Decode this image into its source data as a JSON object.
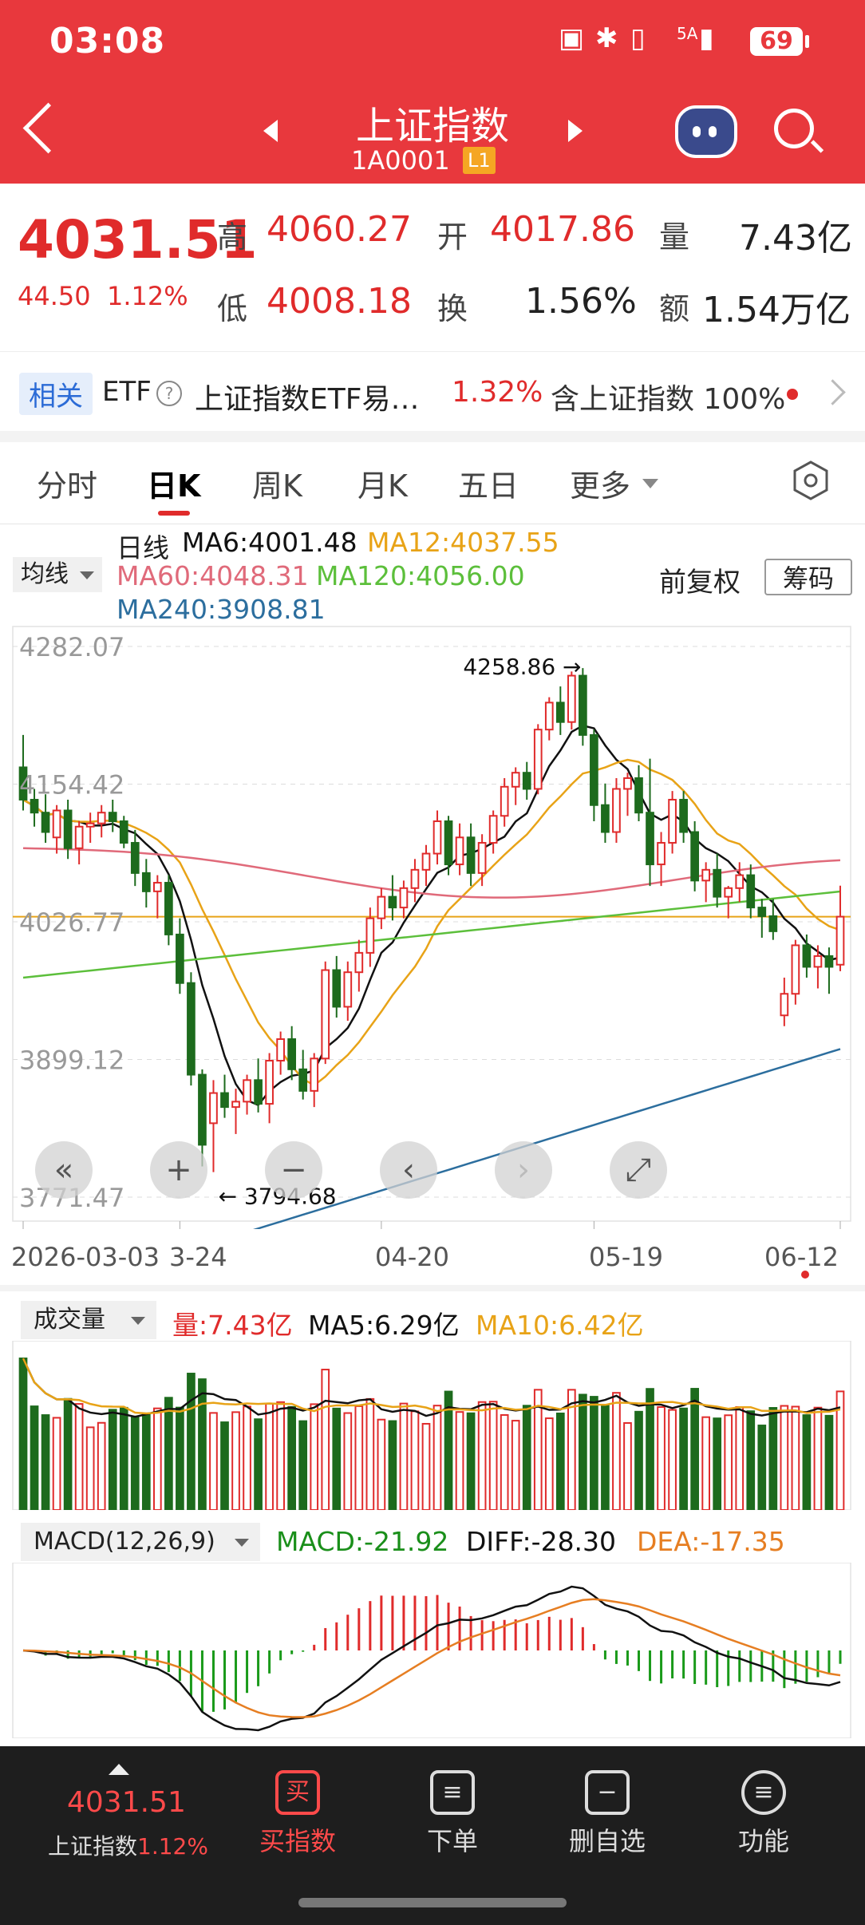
{
  "status_bar": {
    "time": "03:08",
    "network": "5A",
    "battery": "69"
  },
  "header": {
    "title": "上证指数",
    "code": "1A0001",
    "level": "L1"
  },
  "quote": {
    "price": "4031.51",
    "change": "44.50",
    "change_pct": "1.12%",
    "high_label": "高",
    "high": "4060.27",
    "open_label": "开",
    "open": "4017.86",
    "volume_label": "量",
    "volume": "7.43亿",
    "low_label": "低",
    "low": "4008.18",
    "turnover_label": "换",
    "turnover": "1.56%",
    "amount_label": "额",
    "amount": "1.54万亿"
  },
  "etf": {
    "tag": "相关",
    "label": "ETF",
    "name": "上证指数ETF易…",
    "pct": "1.32%",
    "desc": "含上证指数 100%"
  },
  "tabs": [
    "分时",
    "日K",
    "周K",
    "月K",
    "五日",
    "更多"
  ],
  "chart_header": {
    "ma_selector": "均线",
    "period": "日线",
    "ma6": "MA6:4001.48",
    "ma12": "MA12:4037.55",
    "ma60": "MA60:4048.31",
    "ma120": "MA120:4056.00",
    "ma240": "MA240:3908.81",
    "adjust": "前复权",
    "chip_button": "筹码"
  },
  "colors": {
    "up": "#e02b2b",
    "down": "#1d6b1d",
    "ma6": "#111111",
    "ma12": "#e8a317",
    "ma60": "#e06a7a",
    "ma120": "#5cbf3b",
    "ma240": "#2c6e9e",
    "header": "#e8383d"
  },
  "zoom_controls": [
    "«",
    "+",
    "−",
    "‹",
    "›",
    "⤢"
  ],
  "chart_data": {
    "type": "candlestick",
    "y_ticks": [
      "4282.07",
      "4154.42",
      "4026.77",
      "3899.12",
      "3771.47"
    ],
    "ylim": [
      3771.47,
      4282.07
    ],
    "x_labels": [
      "2026-03-03",
      "3-24",
      "04-20",
      "05-19",
      "06-12"
    ],
    "annotations": {
      "high": "4258.86",
      "low": "3794.68"
    },
    "candles": [
      [
        4170,
        4200,
        4130,
        4140
      ],
      [
        4140,
        4150,
        4115,
        4128
      ],
      [
        4128,
        4145,
        4100,
        4110
      ],
      [
        4105,
        4135,
        4090,
        4130
      ],
      [
        4130,
        4140,
        4085,
        4095
      ],
      [
        4095,
        4120,
        4080,
        4115
      ],
      [
        4115,
        4128,
        4100,
        4118
      ],
      [
        4118,
        4135,
        4105,
        4128
      ],
      [
        4128,
        4140,
        4110,
        4120
      ],
      [
        4120,
        4125,
        4095,
        4100
      ],
      [
        4100,
        4112,
        4060,
        4072
      ],
      [
        4072,
        4085,
        4040,
        4055
      ],
      [
        4055,
        4070,
        4030,
        4063
      ],
      [
        4063,
        4070,
        4005,
        4015
      ],
      [
        4015,
        4030,
        3960,
        3970
      ],
      [
        3970,
        3980,
        3875,
        3885
      ],
      [
        3885,
        3890,
        3800,
        3820
      ],
      [
        3840,
        3880,
        3794.68,
        3868
      ],
      [
        3868,
        3885,
        3845,
        3855
      ],
      [
        3855,
        3872,
        3830,
        3860
      ],
      [
        3860,
        3885,
        3848,
        3880
      ],
      [
        3880,
        3900,
        3850,
        3858
      ],
      [
        3858,
        3905,
        3840,
        3898
      ],
      [
        3898,
        3925,
        3885,
        3918
      ],
      [
        3918,
        3930,
        3880,
        3890
      ],
      [
        3890,
        3908,
        3862,
        3870
      ],
      [
        3870,
        3905,
        3855,
        3900
      ],
      [
        3900,
        3990,
        3895,
        3982
      ],
      [
        3982,
        3995,
        3938,
        3948
      ],
      [
        3948,
        3990,
        3935,
        3980
      ],
      [
        3980,
        4010,
        3962,
        3998
      ],
      [
        3998,
        4040,
        3985,
        4030
      ],
      [
        4030,
        4058,
        4020,
        4050
      ],
      [
        4050,
        4070,
        4028,
        4040
      ],
      [
        4040,
        4065,
        4030,
        4058
      ],
      [
        4058,
        4085,
        4045,
        4075
      ],
      [
        4075,
        4098,
        4060,
        4090
      ],
      [
        4090,
        4130,
        4080,
        4120
      ],
      [
        4120,
        4125,
        4070,
        4080
      ],
      [
        4080,
        4118,
        4070,
        4105
      ],
      [
        4105,
        4118,
        4060,
        4072
      ],
      [
        4072,
        4108,
        4060,
        4100
      ],
      [
        4100,
        4130,
        4090,
        4125
      ],
      [
        4125,
        4160,
        4115,
        4152
      ],
      [
        4152,
        4170,
        4135,
        4165
      ],
      [
        4165,
        4175,
        4140,
        4150
      ],
      [
        4150,
        4210,
        4145,
        4205
      ],
      [
        4205,
        4235,
        4195,
        4230
      ],
      [
        4230,
        4245,
        4200,
        4212
      ],
      [
        4212,
        4258.86,
        4205,
        4255
      ],
      [
        4255,
        4262,
        4190,
        4200
      ],
      [
        4200,
        4205,
        4120,
        4135
      ],
      [
        4135,
        4155,
        4100,
        4110
      ],
      [
        4110,
        4160,
        4100,
        4150
      ],
      [
        4150,
        4165,
        4125,
        4160
      ],
      [
        4160,
        4172,
        4120,
        4128
      ],
      [
        4128,
        4178,
        4060,
        4080
      ],
      [
        4080,
        4110,
        4060,
        4100
      ],
      [
        4100,
        4148,
        4090,
        4140
      ],
      [
        4140,
        4148,
        4100,
        4110
      ],
      [
        4110,
        4120,
        4055,
        4065
      ],
      [
        4065,
        4082,
        4045,
        4075
      ],
      [
        4075,
        4090,
        4040,
        4050
      ],
      [
        4050,
        4060,
        4030,
        4058
      ],
      [
        4058,
        4082,
        4045,
        4070
      ],
      [
        4070,
        4080,
        4030,
        4040
      ],
      [
        4040,
        4048,
        4012,
        4032
      ],
      [
        4032,
        4048,
        4010,
        4018
      ],
      [
        3940,
        3975,
        3930,
        3960
      ],
      [
        3960,
        4010,
        3950,
        4005
      ],
      [
        4005,
        4015,
        3975,
        3985
      ],
      [
        3985,
        4005,
        3965,
        3995
      ],
      [
        3995,
        4003,
        3960,
        3985
      ],
      [
        3987,
        4060.27,
        3981,
        4031.51
      ]
    ]
  },
  "volume_panel": {
    "selector": "成交量",
    "vol": "量:7.43亿",
    "ma5": "MA5:6.29亿",
    "ma10": "MA10:6.42亿"
  },
  "macd_panel": {
    "selector": "MACD(12,26,9)",
    "macd": "MACD:-21.92",
    "diff": "DIFF:-28.30",
    "dea": "DEA:-17.35"
  },
  "bottom_bar": {
    "price": "4031.51",
    "name": "上证指数",
    "pct": "1.12%",
    "buy_icon": "买",
    "buy": "买指数",
    "order": "下单",
    "remove": "删自选",
    "functions": "功能"
  }
}
